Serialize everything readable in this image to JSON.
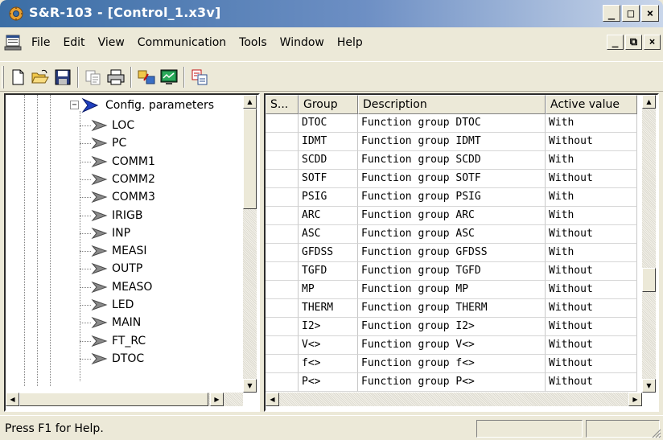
{
  "window": {
    "title": "S&R-103 - [Control_1.x3v]",
    "controls": [
      "_",
      "□",
      "×"
    ],
    "mdi_controls": [
      "_",
      "⧉",
      "×"
    ]
  },
  "menu": {
    "items": [
      "File",
      "Edit",
      "View",
      "Communication",
      "Tools",
      "Window",
      "Help"
    ]
  },
  "toolbar": {
    "buttons": [
      "new-document-icon",
      "open-folder-icon",
      "save-disk-icon",
      "copy-icon",
      "print-icon",
      "transfer-icon",
      "monitor-icon",
      "compare-icon"
    ]
  },
  "tree": {
    "root": {
      "label": "Config. parameters",
      "expanded": true
    },
    "children": [
      "LOC",
      "PC",
      "COMM1",
      "COMM2",
      "COMM3",
      "IRIGB",
      "INP",
      "MEASI",
      "OUTP",
      "MEASO",
      "LED",
      "MAIN",
      "FT_RC",
      "DTOC"
    ],
    "expander_symbol": "−"
  },
  "table": {
    "columns": [
      "S...",
      "Group",
      "Description",
      "Active value"
    ],
    "rows": [
      {
        "s": "",
        "group": "DTOC",
        "description": "Function group DTOC",
        "value": "With"
      },
      {
        "s": "",
        "group": "IDMT",
        "description": "Function group IDMT",
        "value": "Without"
      },
      {
        "s": "",
        "group": "SCDD",
        "description": "Function group SCDD",
        "value": "With"
      },
      {
        "s": "",
        "group": "SOTF",
        "description": "Function group SOTF",
        "value": "Without"
      },
      {
        "s": "",
        "group": "PSIG",
        "description": "Function group PSIG",
        "value": "With"
      },
      {
        "s": "",
        "group": "ARC",
        "description": "Function group ARC",
        "value": "With"
      },
      {
        "s": "",
        "group": "ASC",
        "description": "Function group ASC",
        "value": "Without"
      },
      {
        "s": "",
        "group": "GFDSS",
        "description": "Function group GFDSS",
        "value": "With"
      },
      {
        "s": "",
        "group": "TGFD",
        "description": "Function group TGFD",
        "value": "Without"
      },
      {
        "s": "",
        "group": "MP",
        "description": "Function group MP",
        "value": "Without"
      },
      {
        "s": "",
        "group": "THERM",
        "description": "Function group THERM",
        "value": "Without"
      },
      {
        "s": "",
        "group": "I2>",
        "description": "Function group I2>",
        "value": "Without"
      },
      {
        "s": "",
        "group": "V<>",
        "description": "Function group V<>",
        "value": "Without"
      },
      {
        "s": "",
        "group": "f<>",
        "description": "Function group f<>",
        "value": "Without"
      },
      {
        "s": "",
        "group": "P<>",
        "description": "Function group P<>",
        "value": "Without"
      }
    ]
  },
  "status": {
    "text": "Press F1 for Help."
  },
  "scroll_arrows": {
    "up": "▲",
    "down": "▼",
    "left": "◀",
    "right": "▶"
  },
  "colors": {
    "titlebar_start": "#3b6ea5",
    "titlebar_end": "#c9d6ea",
    "chrome": "#ece9d8",
    "tree_arrow": "#1f3fbf",
    "tree_leaf_arrow": "#7a7a7a"
  }
}
